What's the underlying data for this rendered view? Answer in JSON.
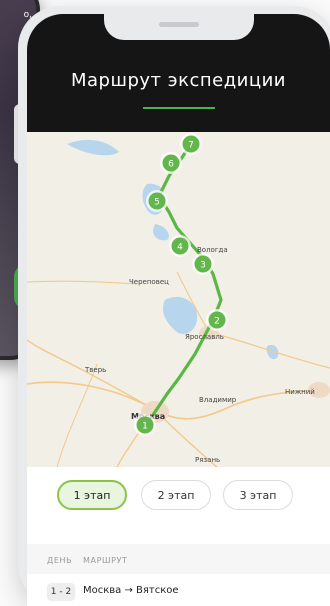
{
  "background_phone": {
    "text": "о,"
  },
  "header": {
    "title": "Маршрут экспедиции"
  },
  "map": {
    "cities": [
      "Череповец",
      "Ярославль",
      "Тверь",
      "Владимир",
      "Нижний",
      "Москва",
      "Рязань",
      "Вологда"
    ],
    "stops": [
      "1",
      "2",
      "3",
      "4",
      "5",
      "6",
      "7"
    ]
  },
  "stages": [
    {
      "label": "1 этап",
      "active": true
    },
    {
      "label": "2 этап",
      "active": false
    },
    {
      "label": "3 этап",
      "active": false
    }
  ],
  "table": {
    "headers": {
      "day": "ДЕНЬ",
      "route": "МАРШРУТ"
    },
    "rows": [
      {
        "day": "1 - 2",
        "route": "Москва → Вятское"
      }
    ]
  },
  "colors": {
    "accent": "#4caf50",
    "header_bg": "#151515",
    "active_stage_bg": "#e9f5de"
  }
}
